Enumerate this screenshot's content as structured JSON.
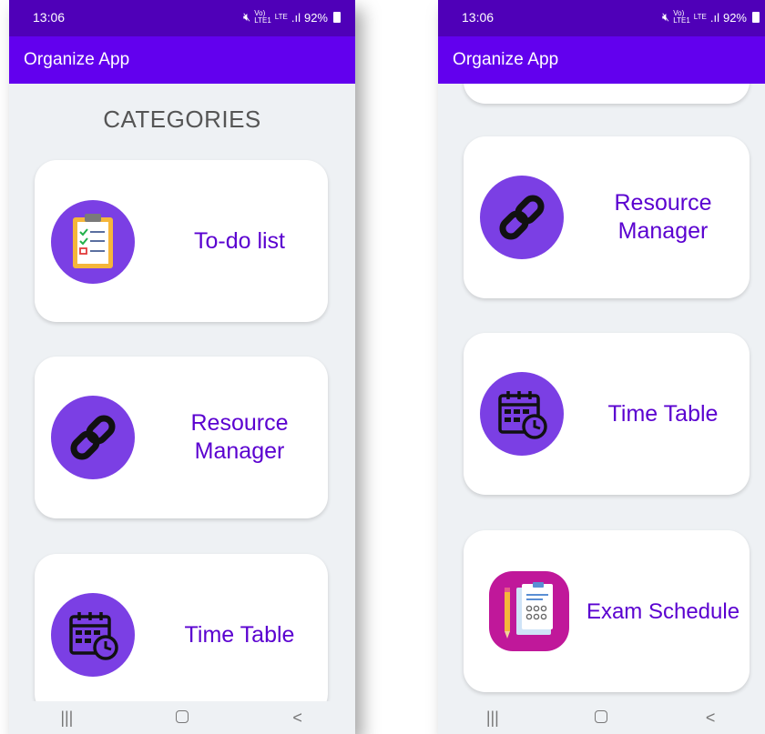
{
  "status_bar": {
    "time": "13:06",
    "signal_top": "Vo)",
    "signal_mid": "LTE",
    "signal_bottom": "LTE1",
    "battery": "92%"
  },
  "app_bar": {
    "title": "Organize App"
  },
  "left_screen": {
    "heading": "CATEGORIES",
    "cards": [
      {
        "label": "To-do list",
        "icon": "clipboard-checklist-icon"
      },
      {
        "label": "Resource Manager",
        "icon": "link-chain-icon"
      },
      {
        "label": "Time Table",
        "icon": "calendar-clock-icon"
      }
    ]
  },
  "right_screen": {
    "cards": [
      {
        "label": "Resource Manager",
        "icon": "link-chain-icon"
      },
      {
        "label": "Time Table",
        "icon": "calendar-clock-icon"
      },
      {
        "label": "Exam Schedule",
        "icon": "exam-document-icon"
      }
    ]
  },
  "nav_bar": {
    "recents_glyph": "|||",
    "back_glyph": "<"
  },
  "colors": {
    "status_bar": "#4f00b8",
    "app_bar": "#6200ee",
    "accent_text": "#5a00d0",
    "icon_circle": "#7b3fe4",
    "exam_icon_bg": "#c0189a",
    "background": "#eef1f4"
  }
}
